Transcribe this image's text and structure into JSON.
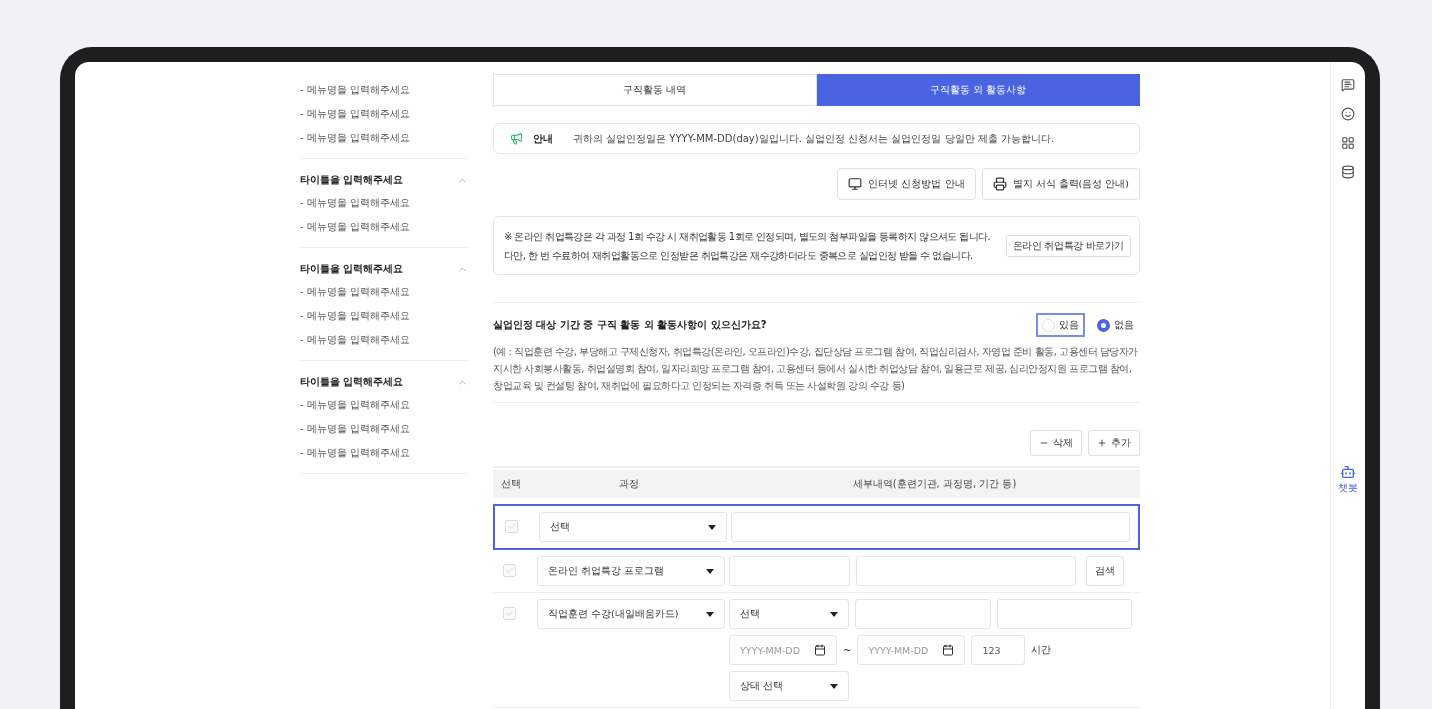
{
  "sidebar": {
    "groups": [
      {
        "items": [
          "- 메뉴명을 입력해주세요",
          "- 메뉴명을 입력해주세요",
          "- 메뉴명을 입력해주세요"
        ]
      },
      {
        "title": "타이틀을 입력해주세요",
        "expanded": true,
        "items": [
          "- 메뉴명을 입력해주세요",
          "- 메뉴명을 입력해주세요"
        ]
      },
      {
        "title": "타이틀을 입력해주세요",
        "expanded": true,
        "items": [
          "- 메뉴명을 입력해주세요",
          "- 메뉴명을 입력해주세요",
          "- 메뉴명을 입력해주세요"
        ]
      },
      {
        "title": "타이틀을 입력해주세요",
        "expanded": true,
        "items": [
          "- 메뉴명을 입력해주세요",
          "- 메뉴명을 입력해주세요",
          "- 메뉴명을 입력해주세요"
        ]
      }
    ]
  },
  "tabs": [
    {
      "label": "구직활동 내역",
      "selected": false
    },
    {
      "label": "구직활동 외 활동사항",
      "selected": true
    }
  ],
  "notice": {
    "label": "안내",
    "text": "귀하의 실업인정일은 YYYY-MM-DD(day)일입니다. 실업인정 신청서는 실업인정일 당일만 제출 가능합니다."
  },
  "guide_buttons": [
    {
      "kind": "monitor",
      "label": "인터넷 신청방법 안내"
    },
    {
      "kind": "printer",
      "label": "별지 서식 출력(음성 안내)"
    }
  ],
  "info": {
    "lines": [
      "※ 온라인 취업특강은 각 과정 1회 수강 시 재취업활동 1회로 인정되며, 별도의 첨부파일을 등록하지 않으셔도 됩니다.",
      "다만, 한 번 수료하여 재취업활동으로 인정받은 취업특강은 재수강하더라도 중복으로 실업인정 받을 수 없습니다."
    ],
    "link": "온라인 취업특강 바로가기"
  },
  "question": {
    "text": "실업인정 대상 기간 중 구직 활동 외 활동사항이 있으신가요?",
    "options": [
      {
        "label": "있음",
        "selected": false,
        "focused": true
      },
      {
        "label": "없음",
        "selected": true,
        "focused": false
      }
    ],
    "example": "(예 : 직업훈련 수강, 부당해고 구제신청자, 취업특강(온라인, 오프라인)수강, 집단상담 프로그램 참여, 직업심리검사, 자영업 준비 활동, 고용센터 담당자가 지시한 사회봉사활동, 취업설명회 참여, 일자리희망 프로그램 참여, 고용센터 등에서 실시한 취업상담 참여, 일용근로 제공, 심리안정지원 프로그램 참여, 창업교육 및 컨설팅 참여, 재취업에 필요하다고 인정되는 자격증 취득 또는 사설학원 강의 수강 등)"
  },
  "row_buttons": [
    {
      "kind": "minus",
      "label": "삭제"
    },
    {
      "kind": "plus",
      "label": "추가"
    }
  ],
  "table": {
    "columns": [
      "선택",
      "과정",
      "세부내역(훈련기관, 과정명, 기간 등)"
    ],
    "rows": [
      {
        "kind": "single",
        "selected": true,
        "disabled": true,
        "course": "선택"
      },
      {
        "kind": "search",
        "selected": false,
        "disabled": true,
        "course": "온라인 취업특강 프로그램",
        "button": "검색"
      },
      {
        "kind": "training",
        "selected": false,
        "disabled": true,
        "course": "직업훈련 수강(내일배움카드)",
        "type_select": "선택",
        "date_from": "YYYY-MM-DD",
        "tilde": "~",
        "date_to": "YYYY-MM-DD",
        "hours": "123",
        "hours_unit": "시간",
        "status_select": "상태 선택"
      }
    ]
  },
  "rail": {
    "bot_label": "챗봇"
  }
}
